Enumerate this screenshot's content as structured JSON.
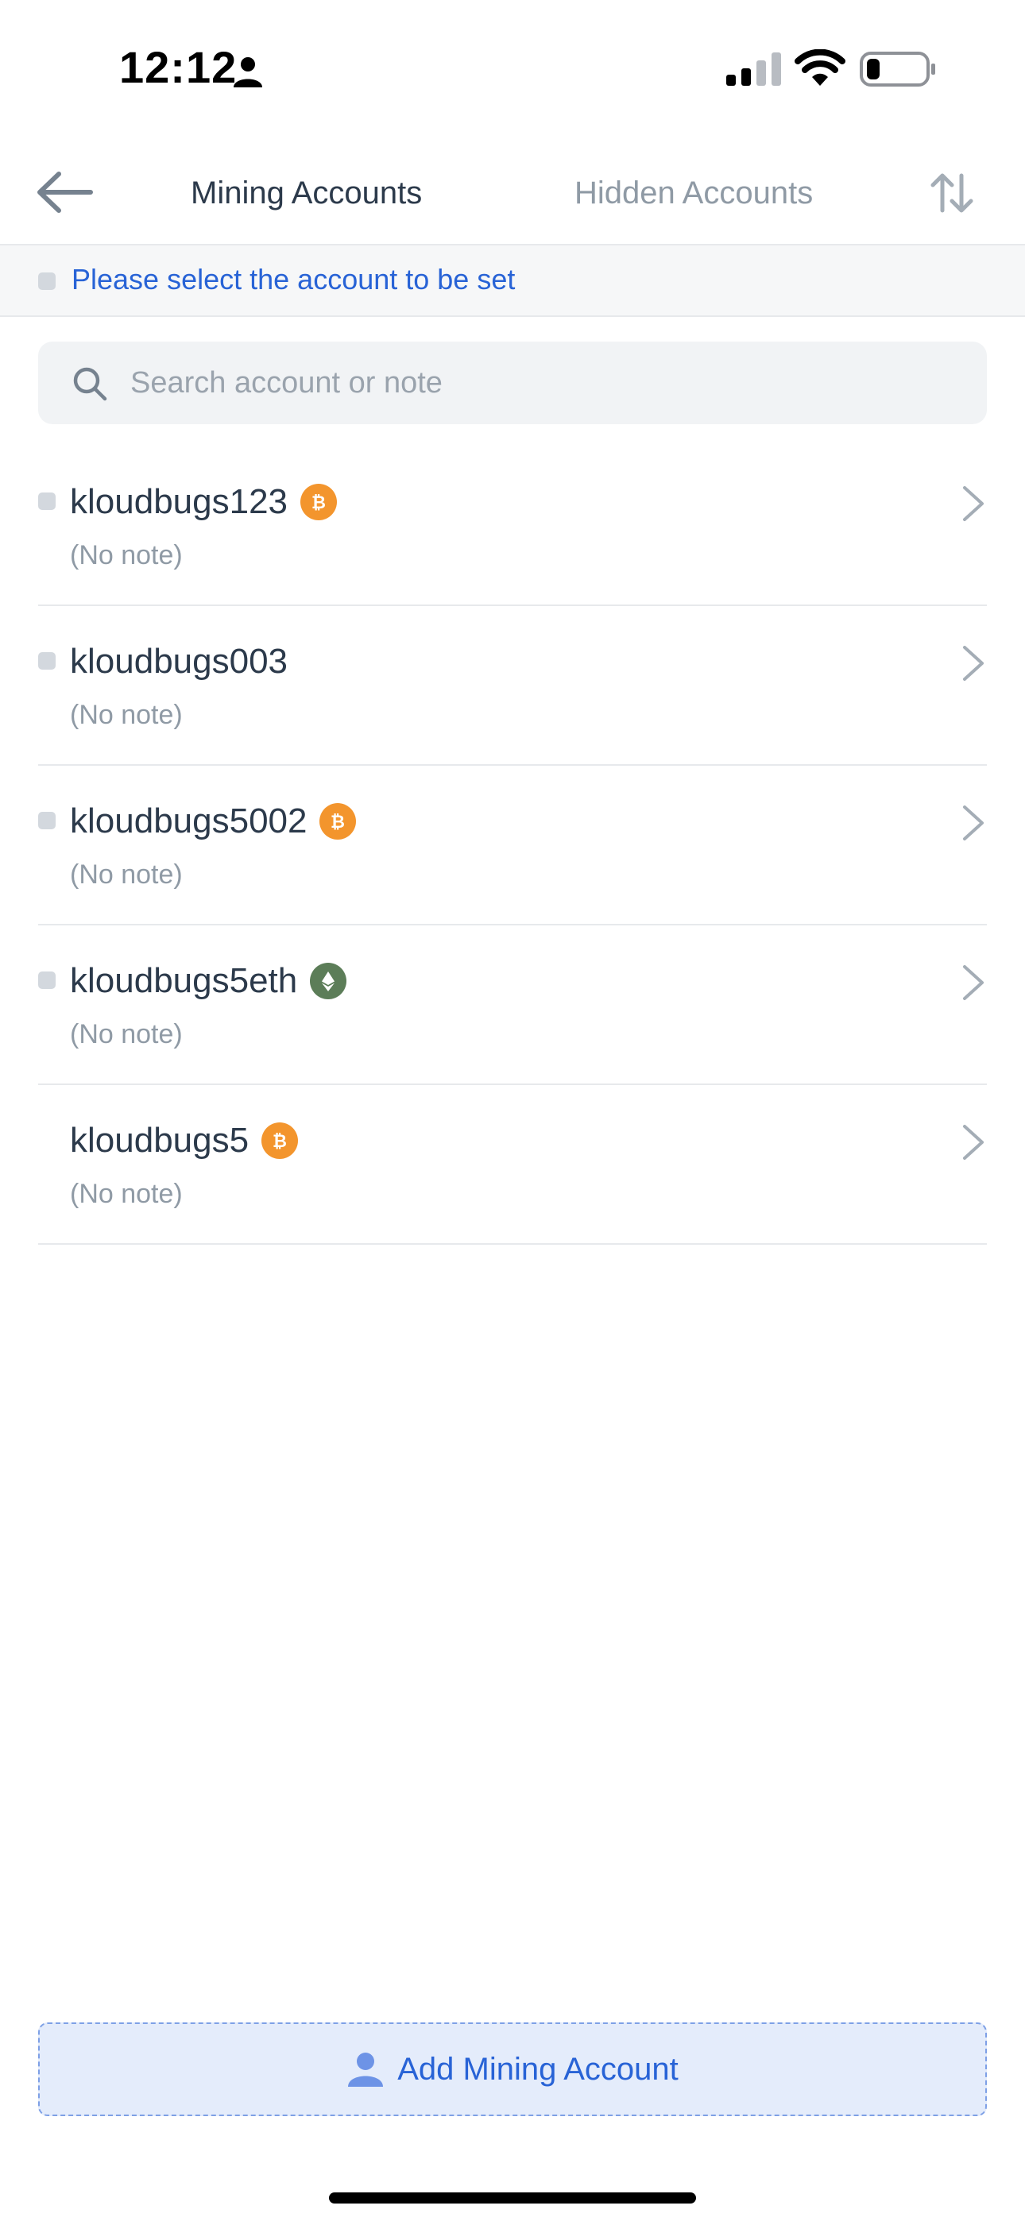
{
  "status_bar": {
    "time": "12:12",
    "person_icon": "person-fill-icon",
    "signal_icon": "cellular-signal-icon",
    "wifi_icon": "wifi-icon",
    "battery_icon": "battery-low-icon"
  },
  "nav": {
    "back_icon": "arrow-left-icon",
    "tabs": [
      {
        "label": "Mining Accounts",
        "active": true
      },
      {
        "label": "Hidden Accounts",
        "active": false
      }
    ],
    "sort_icon": "sort-arrows-icon"
  },
  "notice": {
    "text": "Please select the account to be set"
  },
  "search": {
    "placeholder": "Search account or note",
    "value": "",
    "icon": "search-icon"
  },
  "accounts": [
    {
      "name": "kloudbugs123",
      "coin": "btc",
      "note": "(No note)",
      "selectable": true
    },
    {
      "name": "kloudbugs003",
      "coin": "",
      "note": "(No note)",
      "selectable": true
    },
    {
      "name": "kloudbugs5002",
      "coin": "btc",
      "note": "(No note)",
      "selectable": true
    },
    {
      "name": "kloudbugs5eth",
      "coin": "eth",
      "note": "(No note)",
      "selectable": true
    },
    {
      "name": "kloudbugs5",
      "coin": "btc",
      "note": "(No note)",
      "selectable": false
    }
  ],
  "add_button": {
    "label": "Add Mining Account",
    "icon": "user-icon"
  },
  "colors": {
    "accent": "#2863d6",
    "btc": "#f3952d",
    "eth": "#5c7d58",
    "text_primary": "#2c3a4b",
    "text_secondary": "#8f9aa5"
  }
}
